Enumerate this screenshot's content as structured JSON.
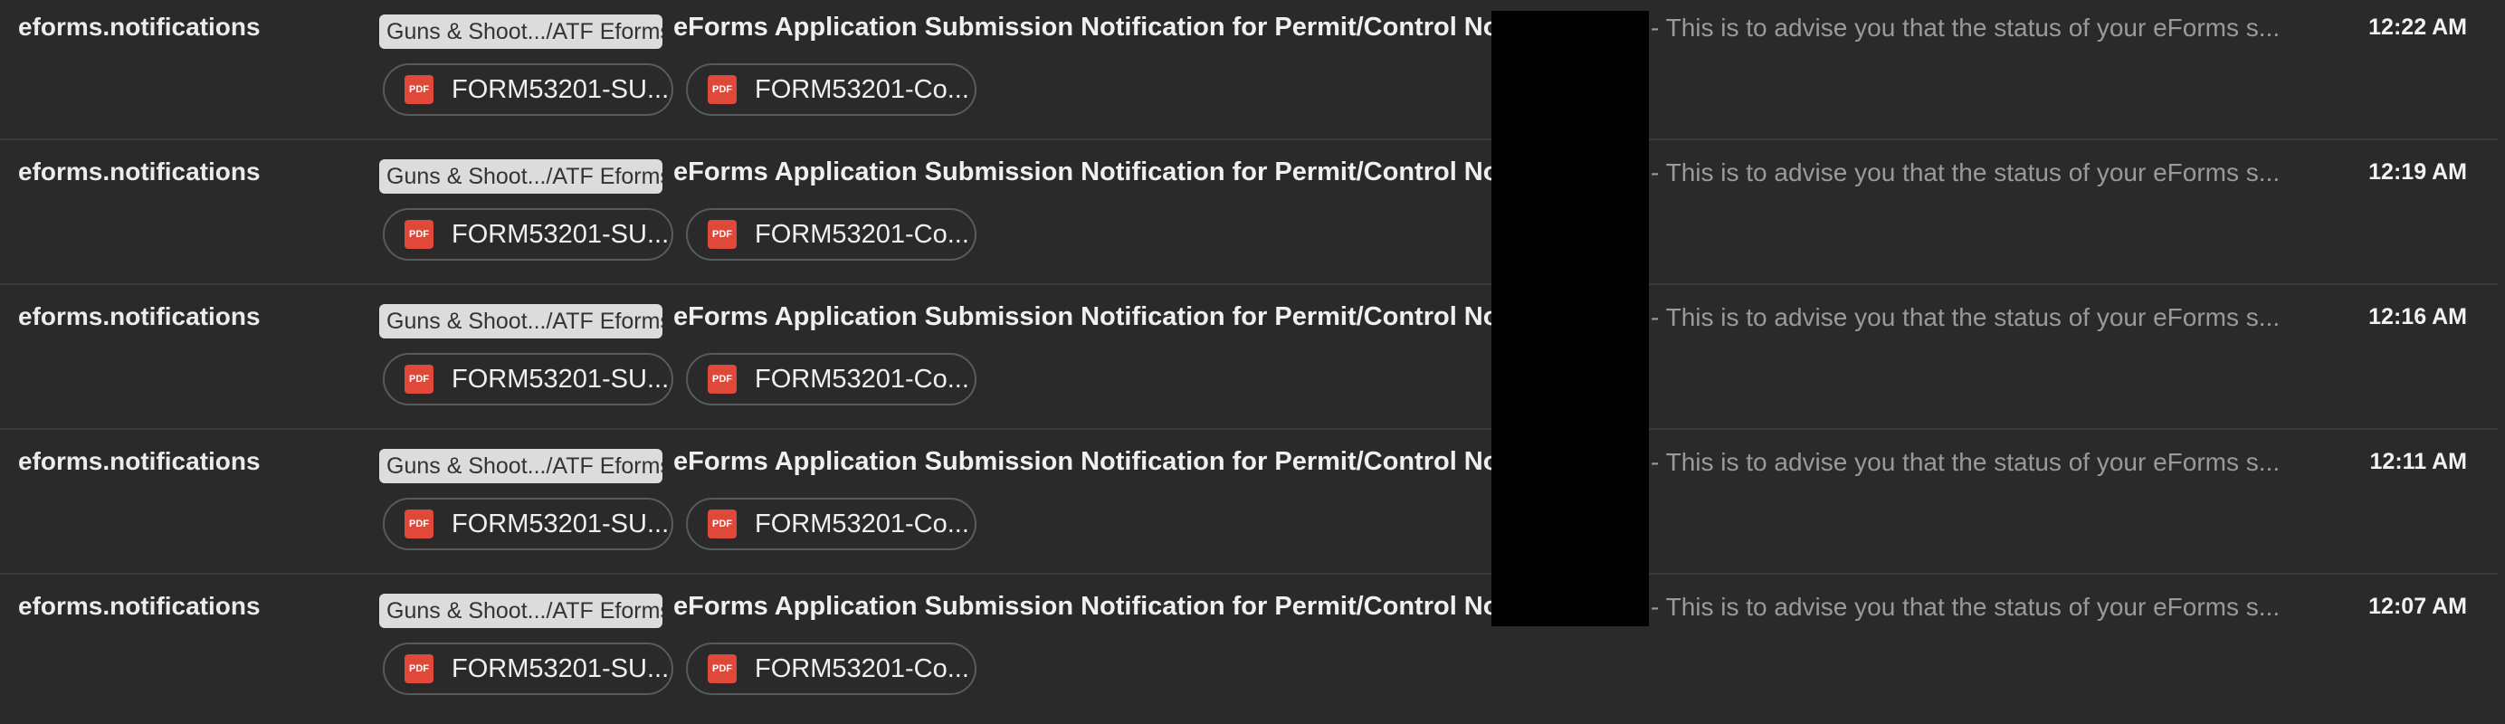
{
  "messages": [
    {
      "sender": "eforms.notifications",
      "label": "Guns & Shoot.../ATF Eforms",
      "subject": "eForms Application Submission Notification for Permit/Control No:",
      "snippet": "- This is to advise you that the status of your eForms s...",
      "time": "12:22 AM",
      "attachments": [
        {
          "icon": "pdf-icon",
          "name": "FORM53201-SU..."
        },
        {
          "icon": "pdf-icon",
          "name": "FORM53201-Co..."
        }
      ]
    },
    {
      "sender": "eforms.notifications",
      "label": "Guns & Shoot.../ATF Eforms",
      "subject": "eForms Application Submission Notification for Permit/Control No:",
      "snippet": "- This is to advise you that the status of your eForms s...",
      "time": "12:19 AM",
      "attachments": [
        {
          "icon": "pdf-icon",
          "name": "FORM53201-SU..."
        },
        {
          "icon": "pdf-icon",
          "name": "FORM53201-Co..."
        }
      ]
    },
    {
      "sender": "eforms.notifications",
      "label": "Guns & Shoot.../ATF Eforms",
      "subject": "eForms Application Submission Notification for Permit/Control No:",
      "snippet": "- This is to advise you that the status of your eForms s...",
      "time": "12:16 AM",
      "attachments": [
        {
          "icon": "pdf-icon",
          "name": "FORM53201-SU..."
        },
        {
          "icon": "pdf-icon",
          "name": "FORM53201-Co..."
        }
      ]
    },
    {
      "sender": "eforms.notifications",
      "label": "Guns & Shoot.../ATF Eforms",
      "subject": "eForms Application Submission Notification for Permit/Control No:",
      "snippet": "- This is to advise you that the status of your eForms s...",
      "time": "12:11 AM",
      "attachments": [
        {
          "icon": "pdf-icon",
          "name": "FORM53201-SU..."
        },
        {
          "icon": "pdf-icon",
          "name": "FORM53201-Co..."
        }
      ]
    },
    {
      "sender": "eforms.notifications",
      "label": "Guns & Shoot.../ATF Eforms",
      "subject": "eForms Application Submission Notification for Permit/Control No:",
      "snippet": "- This is to advise you that the status of your eForms s...",
      "time": "12:07 AM",
      "attachments": [
        {
          "icon": "pdf-icon",
          "name": "FORM53201-SU..."
        },
        {
          "icon": "pdf-icon",
          "name": "FORM53201-Co..."
        }
      ]
    }
  ],
  "pdf_icon_text": "PDF",
  "colors": {
    "background": "#2a2a2a",
    "divider": "#3a3a3a",
    "label_chip": "#dcdcdc",
    "pdf_icon": "#e0493a",
    "redaction": "#000000"
  }
}
